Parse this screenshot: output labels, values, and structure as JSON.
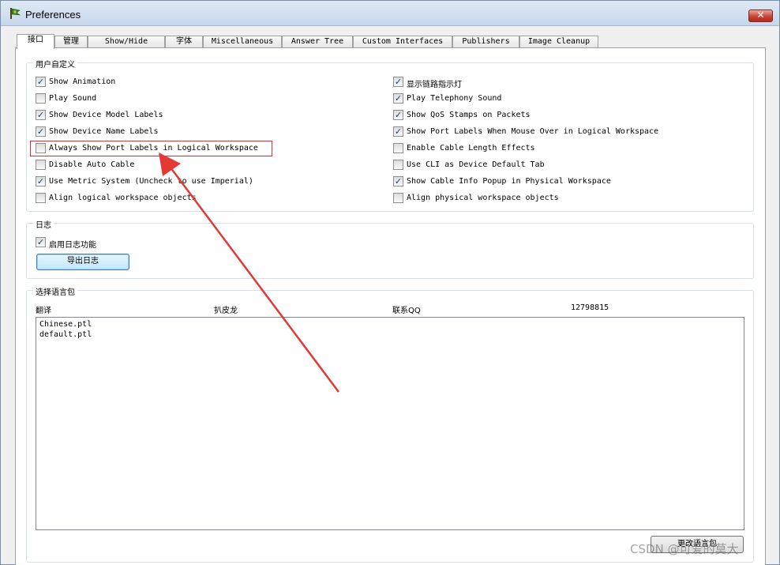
{
  "window": {
    "title": "Preferences",
    "close_glyph": "✕",
    "icon": "packet-tracer-icon"
  },
  "tabs": [
    {
      "label": "接口",
      "active": true
    },
    {
      "label": "管理"
    },
    {
      "label": "Show/Hide"
    },
    {
      "label": "字体"
    },
    {
      "label": "Miscellaneous"
    },
    {
      "label": "Answer Tree"
    },
    {
      "label": "Custom Interfaces"
    },
    {
      "label": "Publishers"
    },
    {
      "label": "Image Cleanup"
    }
  ],
  "customize": {
    "title": "用户自定义",
    "left": [
      {
        "label": "Show Animation",
        "checked": true
      },
      {
        "label": "Play Sound",
        "checked": false
      },
      {
        "label": "Show Device Model Labels",
        "checked": true
      },
      {
        "label": "Show Device Name Labels",
        "checked": true
      },
      {
        "label": "Always Show Port Labels in Logical Workspace",
        "checked": false
      },
      {
        "label": "Disable Auto Cable",
        "checked": false
      },
      {
        "label": "Use Metric System (Uncheck to use Imperial)",
        "checked": true
      },
      {
        "label": "Align logical workspace objects",
        "checked": false
      }
    ],
    "right": [
      {
        "label": "显示链路指示灯",
        "checked": true
      },
      {
        "label": "Play Telephony Sound",
        "checked": true
      },
      {
        "label": "Show QoS Stamps on Packets",
        "checked": true
      },
      {
        "label": "Show Port Labels When Mouse Over in Logical Workspace",
        "checked": true
      },
      {
        "label": "Enable Cable Length Effects",
        "checked": false
      },
      {
        "label": "Use CLI as Device Default Tab",
        "checked": false
      },
      {
        "label": "Show Cable Info Popup in Physical Workspace",
        "checked": true
      },
      {
        "label": "Align physical workspace objects",
        "checked": false
      }
    ]
  },
  "log": {
    "title": "日志",
    "enable_label": "启用日志功能",
    "enable_checked": true,
    "export_button": "导出日志"
  },
  "language": {
    "title": "选择语言包",
    "translate_label": "翻译",
    "translator": "扒皮龙",
    "contact_label": "联系QQ",
    "contact_value": "12798815",
    "files": [
      "Chinese.ptl",
      "default.ptl"
    ],
    "change_button": "更改语言包"
  },
  "watermark": "CSDN @可爱的莫大",
  "annotation": {
    "color": "#e53935"
  }
}
